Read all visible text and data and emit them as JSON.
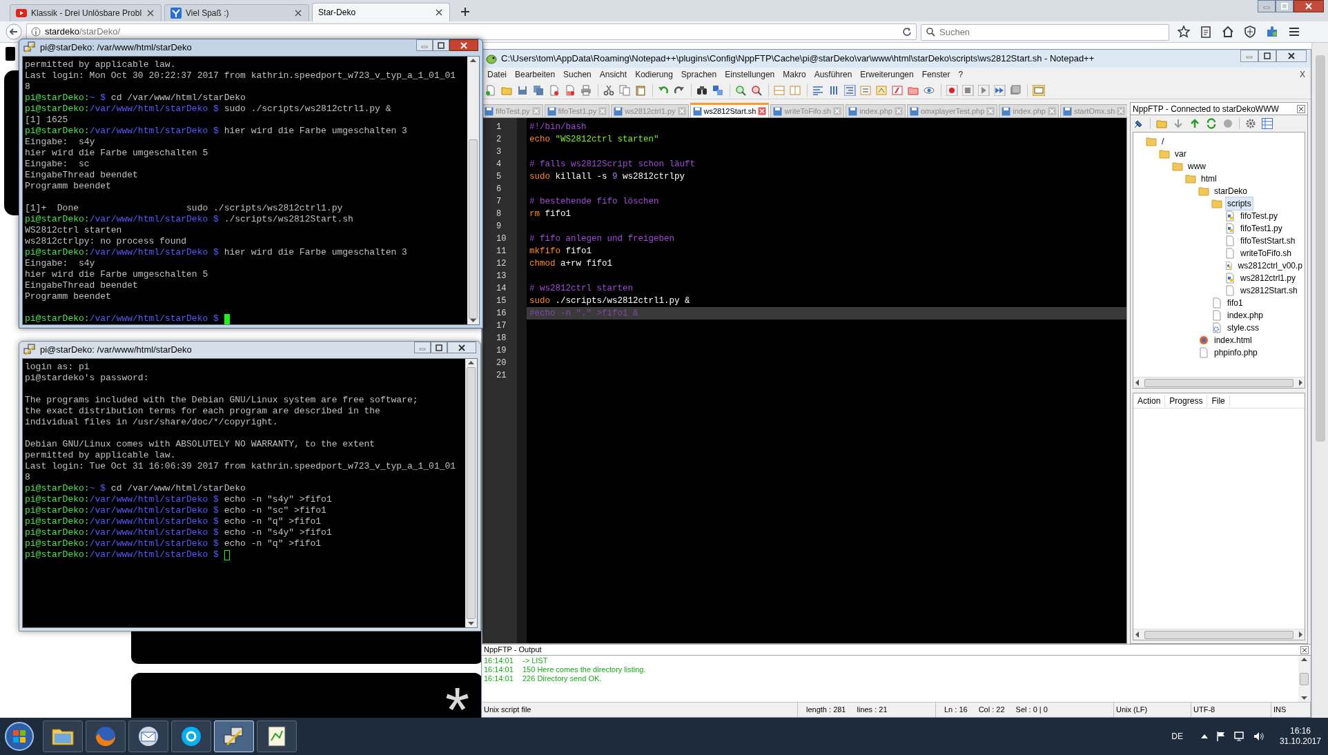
{
  "browser": {
    "tabs": [
      {
        "title": "Klassik - Drei Unlösbare Probl",
        "kind": "video",
        "selected": false
      },
      {
        "title": "Viel Spaß :)",
        "kind": "check",
        "selected": false
      },
      {
        "title": "Star-Deko",
        "kind": "plain",
        "selected": true
      }
    ],
    "url": {
      "host": "stardeko",
      "path": "/starDeko/"
    },
    "search": {
      "placeholder": "Suchen"
    }
  },
  "page": {
    "glyph": "*"
  },
  "terminals": [
    {
      "title": "pi@starDeko: /var/www/html/starDeko",
      "focused": true,
      "lines": [
        {
          "kind": "text",
          "text": "permitted by applicable law."
        },
        {
          "kind": "text",
          "text": "Last login: Mon Oct 30 20:22:37 2017 from kathrin.speedport_w723_v_typ_a_1_01_01"
        },
        {
          "kind": "text",
          "text": "8"
        },
        {
          "kind": "prompt",
          "user": "pi@starDeko:",
          "path": "~ $",
          "command": "cd /var/www/html/starDeko",
          "cursor": false
        },
        {
          "kind": "prompt",
          "user": "pi@starDeko:",
          "path": "/var/www/html/starDeko $",
          "command": "sudo ./scripts/ws2812ctrl1.py &",
          "cursor": false
        },
        {
          "kind": "text",
          "text": "[1] 1625"
        },
        {
          "kind": "prompt",
          "user": "pi@starDeko:",
          "path": "/var/www/html/starDeko $",
          "command": "hier wird die Farbe umgeschalten 3",
          "cursor": false
        },
        {
          "kind": "text",
          "text": "Eingabe:  s4y"
        },
        {
          "kind": "text",
          "text": "hier wird die Farbe umgeschalten 5"
        },
        {
          "kind": "text",
          "text": "Eingabe:  sc"
        },
        {
          "kind": "text",
          "text": "EingabeThread beendet"
        },
        {
          "kind": "text",
          "text": "Programm beendet"
        },
        {
          "kind": "blank"
        },
        {
          "kind": "text",
          "text": "[1]+  Done                    sudo ./scripts/ws2812ctrl1.py"
        },
        {
          "kind": "prompt",
          "user": "pi@starDeko:",
          "path": "/var/www/html/starDeko $",
          "command": "./scripts/ws2812Start.sh",
          "cursor": false
        },
        {
          "kind": "text",
          "text": "WS2812ctrl starten"
        },
        {
          "kind": "text",
          "text": "ws2812ctrlpy: no process found"
        },
        {
          "kind": "prompt",
          "user": "pi@starDeko:",
          "path": "/var/www/html/starDeko $",
          "command": "hier wird die Farbe umgeschalten 3",
          "cursor": false
        },
        {
          "kind": "text",
          "text": "Eingabe:  s4y"
        },
        {
          "kind": "text",
          "text": "hier wird die Farbe umgeschalten 5"
        },
        {
          "kind": "text",
          "text": "EingabeThread beendet"
        },
        {
          "kind": "text",
          "text": "Programm beendet"
        },
        {
          "kind": "blank"
        },
        {
          "kind": "prompt",
          "user": "pi@starDeko:",
          "path": "/var/www/html/starDeko $",
          "cursor": true
        }
      ]
    },
    {
      "title": "pi@starDeko: /var/www/html/starDeko",
      "focused": false,
      "lines": [
        {
          "kind": "text",
          "text": "login as: pi"
        },
        {
          "kind": "text",
          "text": "pi@stardeko's password:"
        },
        {
          "kind": "blank"
        },
        {
          "kind": "text",
          "text": "The programs included with the Debian GNU/Linux system are free software;"
        },
        {
          "kind": "text",
          "text": "the exact distribution terms for each program are described in the"
        },
        {
          "kind": "text",
          "text": "individual files in /usr/share/doc/*/copyright."
        },
        {
          "kind": "blank"
        },
        {
          "kind": "text",
          "text": "Debian GNU/Linux comes with ABSOLUTELY NO WARRANTY, to the extent"
        },
        {
          "kind": "text",
          "text": "permitted by applicable law."
        },
        {
          "kind": "text",
          "text": "Last login: Tue Oct 31 16:06:39 2017 from kathrin.speedport_w723_v_typ_a_1_01_01"
        },
        {
          "kind": "text",
          "text": "8"
        },
        {
          "kind": "prompt",
          "user": "pi@starDeko:",
          "path": "~ $",
          "command": "cd /var/www/html/starDeko",
          "cursor": false
        },
        {
          "kind": "prompt",
          "user": "pi@starDeko:",
          "path": "/var/www/html/starDeko $",
          "command": "echo -n \"s4y\" >fifo1",
          "cursor": false
        },
        {
          "kind": "prompt",
          "user": "pi@starDeko:",
          "path": "/var/www/html/starDeko $",
          "command": "echo -n \"sc\" >fifo1",
          "cursor": false
        },
        {
          "kind": "prompt",
          "user": "pi@starDeko:",
          "path": "/var/www/html/starDeko $",
          "command": "echo -n \"q\" >fifo1",
          "cursor": false
        },
        {
          "kind": "prompt",
          "user": "pi@starDeko:",
          "path": "/var/www/html/starDeko $",
          "command": "echo -n \"s4y\" >fifo1",
          "cursor": false
        },
        {
          "kind": "prompt",
          "user": "pi@starDeko:",
          "path": "/var/www/html/starDeko $",
          "command": "echo -n \"q\" >fifo1",
          "cursor": false
        },
        {
          "kind": "prompt",
          "user": "pi@starDeko:",
          "path": "/var/www/html/starDeko $",
          "cursor": true
        }
      ]
    }
  ],
  "notepad": {
    "title": "C:\\Users\\tom\\AppData\\Roaming\\Notepad++\\plugins\\Config\\NppFTP\\Cache\\pi@starDeko\\var\\www\\html\\starDeko\\scripts\\ws2812Start.sh - Notepad++",
    "menu": [
      "Datei",
      "Bearbeiten",
      "Suchen",
      "Ansicht",
      "Kodierung",
      "Sprachen",
      "Einstellungen",
      "Makro",
      "Ausführen",
      "Erweiterungen",
      "Fenster",
      "?"
    ],
    "menu_close": "X",
    "tabs": [
      {
        "label": "fifoTest.py",
        "selected": false
      },
      {
        "label": "fifoTest1.py",
        "selected": false
      },
      {
        "label": "ws2812ctrl1.py",
        "selected": false
      },
      {
        "label": "ws2812Start.sh",
        "selected": true
      },
      {
        "label": "writeToFifo.sh",
        "selected": false
      },
      {
        "label": "index.php",
        "selected": false
      },
      {
        "label": "omxplayerTest.php",
        "selected": false
      },
      {
        "label": "index.php",
        "selected": false
      },
      {
        "label": "startOmx.sh",
        "selected": false
      }
    ],
    "code_lines": [
      {
        "number": "1",
        "current": false,
        "tokens": [
          {
            "kind": "comment",
            "text": "#!/bin/bash"
          }
        ]
      },
      {
        "number": "2",
        "current": false,
        "tokens": [
          {
            "kind": "keyword",
            "text": "echo"
          },
          {
            "kind": "string",
            "text": " \"WS2812ctrl starten\""
          }
        ]
      },
      {
        "number": "3",
        "current": false
      },
      {
        "number": "4",
        "current": false,
        "tokens": [
          {
            "kind": "comment",
            "text": "# falls ws2812Script schon läuft"
          }
        ]
      },
      {
        "number": "5",
        "current": false,
        "tokens": [
          {
            "kind": "keyword",
            "text": "sudo"
          },
          {
            "kind": "plain",
            "text": " killall -s "
          },
          {
            "kind": "number",
            "text": "9"
          },
          {
            "kind": "plain",
            "text": " ws2812ctrlpy"
          }
        ]
      },
      {
        "number": "6",
        "current": false
      },
      {
        "number": "7",
        "current": false,
        "tokens": [
          {
            "kind": "comment",
            "text": "# bestehende fifo löschen"
          }
        ]
      },
      {
        "number": "8",
        "current": false,
        "tokens": [
          {
            "kind": "keyword",
            "text": "rm"
          },
          {
            "kind": "plain",
            "text": " fifo1"
          }
        ]
      },
      {
        "number": "9",
        "current": false
      },
      {
        "number": "10",
        "current": false,
        "tokens": [
          {
            "kind": "comment",
            "text": "# fifo anlegen und freigeben"
          }
        ]
      },
      {
        "number": "11",
        "current": false,
        "tokens": [
          {
            "kind": "keyword",
            "text": "mkfifo"
          },
          {
            "kind": "plain",
            "text": " fifo1"
          }
        ]
      },
      {
        "number": "12",
        "current": false,
        "tokens": [
          {
            "kind": "keyword",
            "text": "chmod"
          },
          {
            "kind": "plain",
            "text": " a+rw fifo1"
          }
        ]
      },
      {
        "number": "13",
        "current": false
      },
      {
        "number": "14",
        "current": false,
        "tokens": [
          {
            "kind": "comment",
            "text": "# ws2812ctrl starten"
          }
        ]
      },
      {
        "number": "15",
        "current": false,
        "tokens": [
          {
            "kind": "keyword",
            "text": "sudo"
          },
          {
            "kind": "plain",
            "text": " ./scripts/ws2812ctrl1.py &"
          }
        ]
      },
      {
        "number": "16",
        "current": true,
        "tokens": [
          {
            "kind": "comment",
            "text": "#echo -n \".\" >fifo1 &"
          }
        ]
      },
      {
        "number": "17",
        "current": false
      },
      {
        "number": "18",
        "current": false
      },
      {
        "number": "19",
        "current": false
      },
      {
        "number": "20",
        "current": false
      },
      {
        "number": "21",
        "current": false
      }
    ],
    "ftp_panel": {
      "title": "NppFTP - Connected to starDekoWWW",
      "tree": [
        {
          "label": "/",
          "kind": "folder",
          "selected": false,
          "children": [
            {
              "label": "var",
              "kind": "folder",
              "selected": false,
              "children": [
                {
                  "label": "www",
                  "kind": "folder",
                  "selected": false,
                  "children": [
                    {
                      "label": "html",
                      "kind": "folder",
                      "selected": false,
                      "children": [
                        {
                          "label": "starDeko",
                          "kind": "folder",
                          "selected": false,
                          "children": [
                            {
                              "label": "scripts",
                              "kind": "folder",
                              "selected": true,
                              "children": [
                                {
                                  "label": "fifoTest.py",
                                  "kind": "python",
                                  "selected": false
                                },
                                {
                                  "label": "fifoTest1.py",
                                  "kind": "python",
                                  "selected": false
                                },
                                {
                                  "label": "fifoTestStart.sh",
                                  "kind": "file",
                                  "selected": false
                                },
                                {
                                  "label": "writeToFifo.sh",
                                  "kind": "file",
                                  "selected": false
                                },
                                {
                                  "label": "ws2812ctrl_v00.p",
                                  "kind": "python",
                                  "selected": false
                                },
                                {
                                  "label": "ws2812ctrl1.py",
                                  "kind": "python",
                                  "selected": false
                                },
                                {
                                  "label": "ws2812Start.sh",
                                  "kind": "file",
                                  "selected": false
                                }
                              ]
                            },
                            {
                              "label": "fifo1",
                              "kind": "file",
                              "selected": false
                            },
                            {
                              "label": "index.php",
                              "kind": "file",
                              "selected": false
                            },
                            {
                              "label": "style.css",
                              "kind": "css",
                              "selected": false
                            }
                          ]
                        },
                        {
                          "label": "index.html",
                          "kind": "html",
                          "selected": false
                        },
                        {
                          "label": "phpinfo.php",
                          "kind": "file",
                          "selected": false
                        }
                      ]
                    }
                  ]
                }
              ]
            }
          ]
        }
      ],
      "queue_columns": [
        "Action",
        "Progress",
        "File"
      ]
    },
    "output": {
      "title": "NppFTP - Output",
      "lines": [
        {
          "time": "16:14:01",
          "message": "-> LIST"
        },
        {
          "time": "16:14:01",
          "message": "150 Here comes the directory listing."
        },
        {
          "time": "16:14:01",
          "message": "226 Directory send OK."
        }
      ]
    },
    "status_bar": {
      "file_type": "Unix script file",
      "length": "length : 281",
      "lines": "lines : 21",
      "ln": "Ln : 16",
      "col": "Col : 22",
      "sel": "Sel : 0 | 0",
      "eol": "Unix (LF)",
      "encoding": "UTF-8",
      "mode": "INS"
    }
  },
  "taskbar": {
    "apps": [
      {
        "kind": "folder",
        "selected": false
      },
      {
        "kind": "browser",
        "selected": false
      },
      {
        "kind": "mail",
        "selected": false
      },
      {
        "kind": "skype",
        "selected": false
      },
      {
        "kind": "putty",
        "selected": true
      },
      {
        "kind": "notepad",
        "selected": false
      }
    ],
    "language": "DE",
    "time": "16:16",
    "date": "31.10.2017"
  }
}
